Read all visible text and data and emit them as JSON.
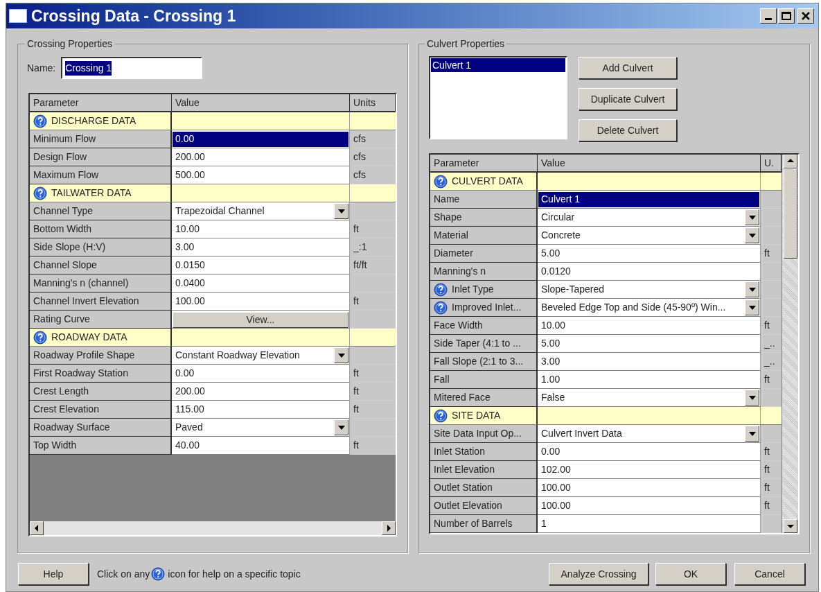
{
  "window": {
    "title": "Crossing Data - Crossing 1"
  },
  "crossing_properties": {
    "title": "Crossing Properties",
    "name_label": "Name:",
    "name_value": "Crossing 1",
    "table": {
      "columns": [
        "Parameter",
        "Value",
        "Units"
      ],
      "rows": [
        {
          "kind": "section",
          "label": "DISCHARGE DATA",
          "help": true
        },
        {
          "kind": "text",
          "label": "Minimum Flow",
          "value": "0.00",
          "units": "cfs",
          "help": false,
          "selected": true
        },
        {
          "kind": "text",
          "label": "Design Flow",
          "value": "200.00",
          "units": "cfs",
          "help": false,
          "selected": false
        },
        {
          "kind": "text",
          "label": "Maximum Flow",
          "value": "500.00",
          "units": "cfs",
          "help": false,
          "selected": false
        },
        {
          "kind": "section",
          "label": "TAILWATER DATA",
          "help": true
        },
        {
          "kind": "dropdown",
          "label": "Channel Type",
          "value": "Trapezoidal Channel",
          "help": false,
          "selected": false
        },
        {
          "kind": "text",
          "label": "Bottom Width",
          "value": "10.00",
          "units": "ft",
          "help": false,
          "selected": false
        },
        {
          "kind": "text",
          "label": "Side Slope (H:V)",
          "value": "3.00",
          "units": "_:1",
          "help": false,
          "selected": false
        },
        {
          "kind": "text",
          "label": "Channel Slope",
          "value": "0.0150",
          "units": "ft/ft",
          "help": false,
          "selected": false
        },
        {
          "kind": "text",
          "label": "Manning's n (channel)",
          "value": "0.0400",
          "help": false,
          "selected": false
        },
        {
          "kind": "text",
          "label": "Channel Invert Elevation",
          "value": "100.00",
          "units": "ft",
          "help": false,
          "selected": false
        },
        {
          "kind": "button",
          "label": "Rating Curve",
          "value": "View...",
          "help": false,
          "selected": false
        },
        {
          "kind": "section",
          "label": "ROADWAY DATA",
          "help": true
        },
        {
          "kind": "dropdown",
          "label": "Roadway Profile Shape",
          "value": "Constant Roadway Elevation",
          "help": false,
          "selected": false
        },
        {
          "kind": "text",
          "label": "First Roadway Station",
          "value": "0.00",
          "units": "ft",
          "help": false,
          "selected": false
        },
        {
          "kind": "text",
          "label": "Crest Length",
          "value": "200.00",
          "units": "ft",
          "help": false,
          "selected": false
        },
        {
          "kind": "text",
          "label": "Crest Elevation",
          "value": "115.00",
          "units": "ft",
          "help": false,
          "selected": false
        },
        {
          "kind": "dropdown",
          "label": "Roadway Surface",
          "value": "Paved",
          "help": false,
          "selected": false
        },
        {
          "kind": "text",
          "label": "Top Width",
          "value": "40.00",
          "units": "ft",
          "help": false,
          "selected": false
        }
      ]
    }
  },
  "culvert_properties": {
    "title": "Culvert Properties",
    "culverts": [
      {
        "label": "Culvert 1",
        "selected": true
      }
    ],
    "buttons": [
      "Add Culvert",
      "Duplicate Culvert",
      "Delete Culvert"
    ],
    "table": {
      "columns": [
        "Parameter",
        "Value",
        "U."
      ],
      "rows": [
        {
          "kind": "section",
          "label": "CULVERT DATA",
          "help": true
        },
        {
          "kind": "text",
          "label": "Name",
          "value": "Culvert 1",
          "help": false,
          "selected": true
        },
        {
          "kind": "dropdown",
          "label": "Shape",
          "value": "Circular",
          "help": false,
          "selected": false
        },
        {
          "kind": "dropdown",
          "label": "Material",
          "value": "Concrete",
          "help": false,
          "selected": false
        },
        {
          "kind": "text",
          "label": "Diameter",
          "value": "5.00",
          "units": "ft",
          "help": false,
          "selected": false
        },
        {
          "kind": "text",
          "label": "Manning's n",
          "value": "0.0120",
          "help": false,
          "selected": false
        },
        {
          "kind": "dropdown",
          "label": "Inlet Type",
          "value": "Slope-Tapered",
          "help": true,
          "selected": false
        },
        {
          "kind": "dropdown",
          "label": "Improved Inlet...",
          "value": "Beveled Edge Top and Side (45-90º) Win...",
          "help": true,
          "selected": false
        },
        {
          "kind": "text",
          "label": "Face Width",
          "value": "10.00",
          "units": "ft",
          "help": false,
          "selected": false
        },
        {
          "kind": "text",
          "label": "Side Taper (4:1 to ...",
          "value": "5.00",
          "units": "_..",
          "help": false,
          "selected": false
        },
        {
          "kind": "text",
          "label": "Fall Slope (2:1 to 3...",
          "value": "3.00",
          "units": "_..",
          "help": false,
          "selected": false
        },
        {
          "kind": "text",
          "label": "Fall",
          "value": "1.00",
          "units": "ft",
          "help": false,
          "selected": false
        },
        {
          "kind": "dropdown",
          "label": "Mitered Face",
          "value": "False",
          "help": false,
          "selected": false
        },
        {
          "kind": "section",
          "label": "SITE DATA",
          "help": true
        },
        {
          "kind": "dropdown",
          "label": "Site Data Input Op...",
          "value": "Culvert Invert Data",
          "help": false,
          "selected": false
        },
        {
          "kind": "text",
          "label": "Inlet Station",
          "value": "0.00",
          "units": "ft",
          "help": false,
          "selected": false
        },
        {
          "kind": "text",
          "label": "Inlet Elevation",
          "value": "102.00",
          "units": "ft",
          "help": false,
          "selected": false
        },
        {
          "kind": "text",
          "label": "Outlet Station",
          "value": "100.00",
          "units": "ft",
          "help": false,
          "selected": false
        },
        {
          "kind": "text",
          "label": "Outlet Elevation",
          "value": "100.00",
          "units": "ft",
          "help": false,
          "selected": false
        },
        {
          "kind": "text",
          "label": "Number of Barrels",
          "value": "1",
          "help": false,
          "selected": false
        }
      ]
    }
  },
  "footer": {
    "help_button": "Help",
    "hint_before": "Click on any",
    "hint_after": "icon for help on a specific topic",
    "buttons": [
      "Analyze Crossing",
      "OK",
      "Cancel"
    ]
  }
}
